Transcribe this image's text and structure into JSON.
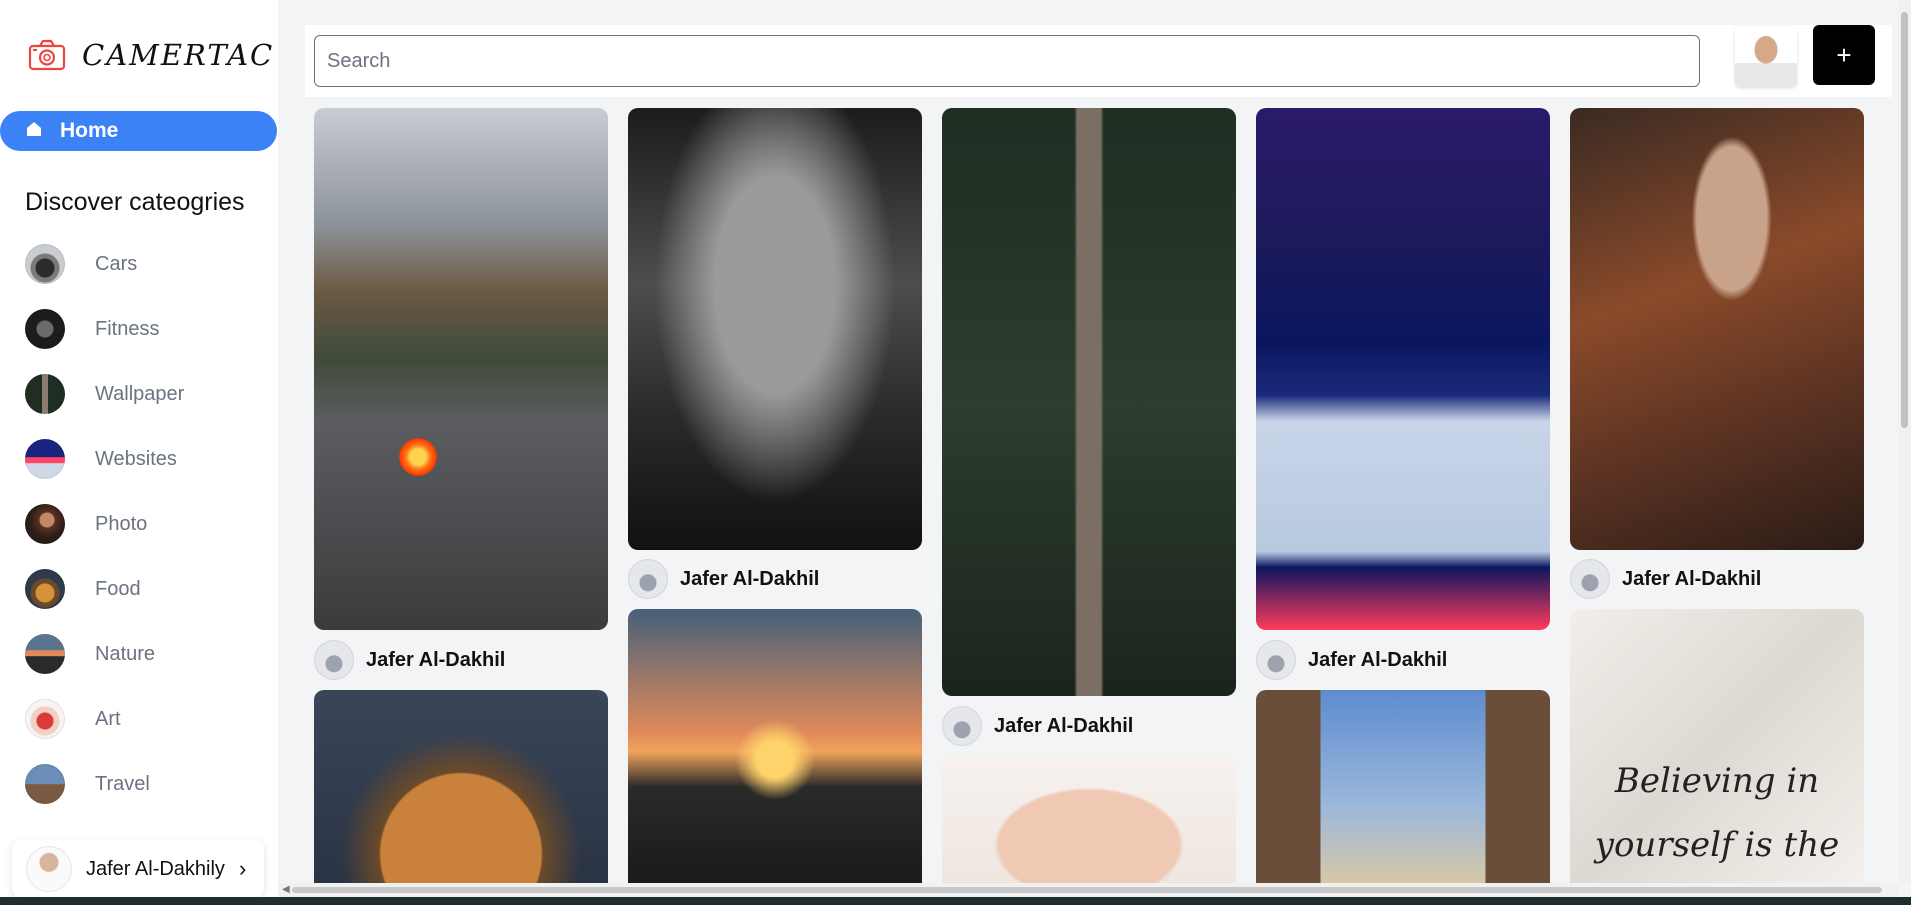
{
  "app": {
    "name": "CAMERTAC",
    "logo_icon": "camera-icon",
    "brand_color": "#3b82f6",
    "add_button_color": "#000000"
  },
  "sidebar": {
    "home_label": "Home",
    "home_icon": "home-icon",
    "discover_title": "Discover cateogries",
    "categories": [
      {
        "label": "Cars"
      },
      {
        "label": "Fitness"
      },
      {
        "label": "Wallpaper"
      },
      {
        "label": "Websites"
      },
      {
        "label": "Photo"
      },
      {
        "label": "Food"
      },
      {
        "label": "Nature"
      },
      {
        "label": "Art"
      },
      {
        "label": "Travel"
      }
    ],
    "profile": {
      "name": "Jafer Al-Dakhily",
      "chevron": "›"
    }
  },
  "topbar": {
    "search_placeholder": "Search",
    "add_label": "+"
  },
  "pins": [
    {
      "author": "Jafer Al-Dakhil"
    },
    {
      "author": "Jafer Al-Dakhil"
    },
    {
      "author": "Jafer Al-Dakhil"
    },
    {
      "author": "Jafer Al-Dakhil"
    },
    {
      "author": "Jafer Al-Dakhil"
    }
  ],
  "marble_quote": {
    "line1": "Believing in",
    "line2": "yourself is the"
  }
}
